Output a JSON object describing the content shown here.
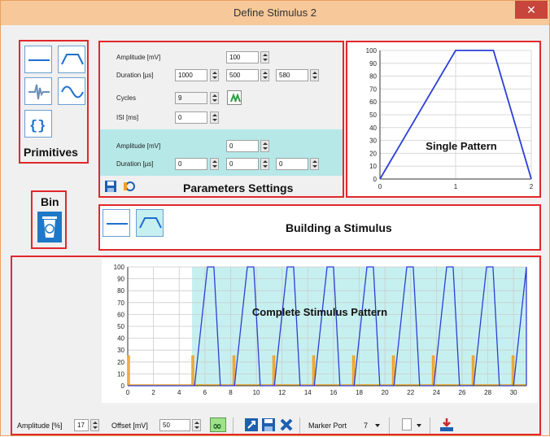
{
  "window": {
    "title": "Define Stimulus 2",
    "close_glyph": "✕"
  },
  "primitives": {
    "label": "Primitives",
    "icons": [
      "flat-line-icon",
      "trapezoid-icon",
      "pulse-icon",
      "sine-icon",
      "braces-icon"
    ]
  },
  "bin": {
    "label": "Bin"
  },
  "parameters": {
    "title": "Parameters Settings",
    "amplitude_label": "Amplitude [mV]",
    "amplitude_value": "100",
    "duration_label": "Duration [µs]",
    "duration_values": [
      "1000",
      "500",
      "580"
    ],
    "cycles_label": "Cycles",
    "cycles_value": "9",
    "isi_label": "ISI [ms]",
    "isi_value": "0",
    "amplitude2_label": "Amplitude [mV]",
    "amplitude2_value": "0",
    "duration2_label": "Duration [µs]",
    "duration2_values": [
      "0",
      "0",
      "0"
    ]
  },
  "building": {
    "title": "Building a Stimulus"
  },
  "chart_data": [
    {
      "type": "line",
      "title": "Single Pattern",
      "x": [
        0,
        1,
        1.5,
        2
      ],
      "values": [
        0,
        100,
        100,
        0
      ],
      "xlim": [
        0,
        2
      ],
      "ylim": [
        0,
        100
      ],
      "xticks": [
        "0",
        "1",
        "2"
      ],
      "yticks": [
        "0",
        "10",
        "20",
        "30",
        "40",
        "50",
        "60",
        "70",
        "80",
        "90",
        "100"
      ],
      "color": "#2b3fd6"
    },
    {
      "type": "line",
      "title": "Complete Stimulus Pattern",
      "xlim": [
        0,
        31
      ],
      "ylim": [
        0,
        100
      ],
      "xticks": [
        "0",
        "2",
        "4",
        "6",
        "8",
        "10",
        "12",
        "14",
        "16",
        "18",
        "20",
        "22",
        "24",
        "26",
        "28",
        "30"
      ],
      "yticks": [
        "0",
        "10",
        "20",
        "30",
        "40",
        "50",
        "60",
        "70",
        "80",
        "90",
        "100"
      ],
      "pulse_starts": [
        5.2,
        8.3,
        11.4,
        14.5,
        17.6,
        20.7,
        23.8,
        26.9,
        30.0
      ],
      "pulse_shape_x": [
        0,
        1,
        1.5,
        2
      ],
      "pulse_shape_y": [
        0,
        100,
        100,
        0
      ],
      "marker_amplitude": 25,
      "marker_starts": [
        0,
        5,
        8.2,
        11.3,
        14.4,
        17.5,
        20.6,
        23.7,
        26.8,
        29.9
      ],
      "shaded_start": 5,
      "line_color": "#2b3fd6",
      "marker_color": "#f0a020",
      "shade_color": "#c6f0f0"
    }
  ],
  "bottom": {
    "amplitude_label": "Amplitude [%]",
    "amplitude_value": "17",
    "offset_label": "Offset [mV]",
    "offset_value": "50",
    "marker_port_label": "Marker Port",
    "marker_port_value": "7"
  }
}
